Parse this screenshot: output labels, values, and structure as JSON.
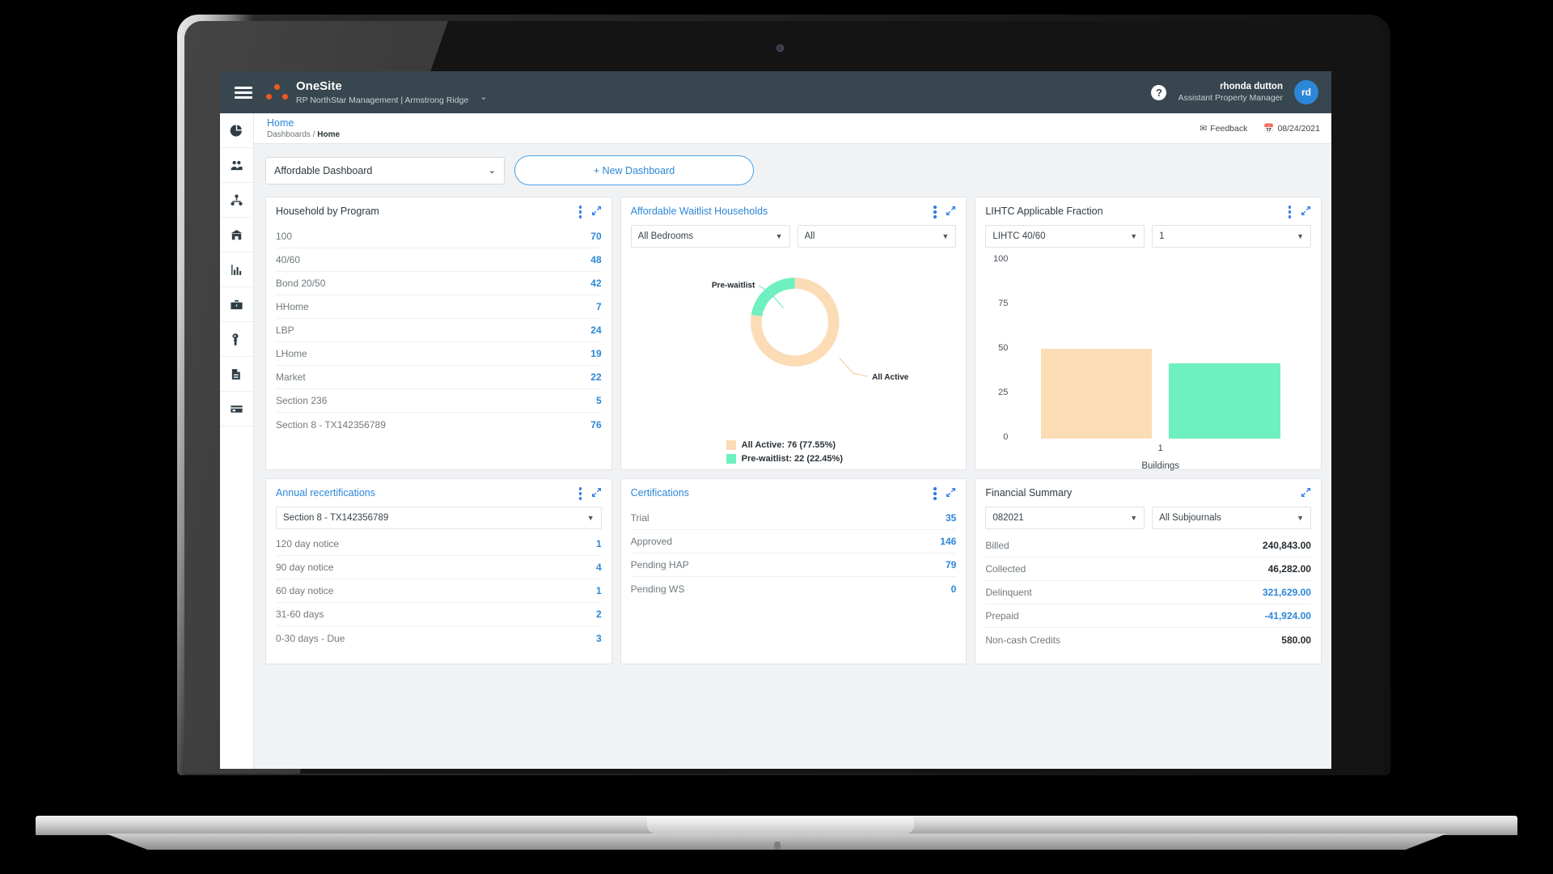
{
  "navbar": {
    "menu_icon": "hamburger-icon",
    "logo_icon": "three-dot-logo",
    "brand_name": "OneSite",
    "brand_sub": "RP NorthStar Management | Armstrong Ridge",
    "brand_caret": "⌄",
    "help_icon": "?",
    "user_name": "rhonda dutton",
    "user_role": "Assistant Property Manager",
    "avatar_initials": "rd",
    "avatar_color": "#2c87d8",
    "bg_color": "#37464f"
  },
  "sidebar": {
    "items": [
      {
        "name": "sidebar-item-dashboards",
        "icon": "pie-chart-icon"
      },
      {
        "name": "sidebar-item-residents",
        "icon": "people-icon"
      },
      {
        "name": "sidebar-item-org",
        "icon": "org-chart-icon"
      },
      {
        "name": "sidebar-item-property",
        "icon": "building-icon"
      },
      {
        "name": "sidebar-item-reports",
        "icon": "bar-chart-icon"
      },
      {
        "name": "sidebar-item-accounting",
        "icon": "briefcase-icon"
      },
      {
        "name": "sidebar-item-maintenance",
        "icon": "wrench-icon"
      },
      {
        "name": "sidebar-item-documents",
        "icon": "documents-icon"
      },
      {
        "name": "sidebar-item-payments",
        "icon": "card-icon"
      }
    ]
  },
  "breadcrumb": {
    "title": "Home",
    "path_prefix": "Dashboards / ",
    "path_current": "Home",
    "feedback_label": "Feedback",
    "feedback_icon": "envelope-icon",
    "date": "08/24/2021",
    "date_icon": "calendar-icon"
  },
  "toolbar": {
    "dashboard_select": "Affordable Dashboard",
    "caret": "⌄",
    "new_dashboard_label": "+ New Dashboard"
  },
  "colors": {
    "accent_blue": "#2c87d8",
    "peach": "#fbdcb5",
    "green": "#6ff0c0",
    "navbar": "#37464f"
  },
  "cards": {
    "household_by_program": {
      "title": "Household by Program",
      "rows": [
        {
          "label": "100",
          "value": "70"
        },
        {
          "label": "40/60",
          "value": "48"
        },
        {
          "label": "Bond 20/50",
          "value": "42"
        },
        {
          "label": "HHome",
          "value": "7"
        },
        {
          "label": "LBP",
          "value": "24"
        },
        {
          "label": "LHome",
          "value": "19"
        },
        {
          "label": "Market",
          "value": "22"
        },
        {
          "label": "Section 236",
          "value": "5"
        },
        {
          "label": "Section 8 - TX142356789",
          "value": "76"
        }
      ]
    },
    "affordable_waitlist": {
      "title": "Affordable Waitlist Households",
      "filter_bedrooms": "All Bedrooms",
      "filter_status": "All",
      "label_pre": "Pre-waitlist",
      "label_active": "All Active",
      "legend": [
        "All Active: 76 (77.55%)",
        "Pre-waitlist: 22 (22.45%)"
      ]
    },
    "lihtc": {
      "title": "LIHTC Applicable Fraction",
      "filter_program": "LIHTC 40/60",
      "filter_building": "1"
    },
    "annual_recerts": {
      "title": "Annual recertifications",
      "filter": "Section 8 - TX142356789",
      "rows": [
        {
          "label": "120 day notice",
          "value": "1"
        },
        {
          "label": "90 day notice",
          "value": "4"
        },
        {
          "label": "60 day notice",
          "value": "1"
        },
        {
          "label": "31-60 days",
          "value": "2"
        },
        {
          "label": "0-30 days - Due",
          "value": "3"
        }
      ]
    },
    "certifications": {
      "title": "Certifications",
      "rows": [
        {
          "label": "Trial",
          "value": "35"
        },
        {
          "label": "Approved",
          "value": "146"
        },
        {
          "label": "Pending HAP",
          "value": "79"
        },
        {
          "label": "Pending WS",
          "value": "0"
        }
      ]
    },
    "financial_summary": {
      "title": "Financial Summary",
      "filter_period": "082021",
      "filter_subjournal": "All Subjournals",
      "rows": [
        {
          "label": "Billed",
          "value": "240,843.00",
          "style": "dark"
        },
        {
          "label": "Collected",
          "value": "46,282.00",
          "style": "dark"
        },
        {
          "label": "Delinquent",
          "value": "321,629.00",
          "style": "blue"
        },
        {
          "label": "Prepaid",
          "value": "-41,924.00",
          "style": "blue"
        },
        {
          "label": "Non-cash Credits",
          "value": "580.00",
          "style": "dark"
        }
      ]
    }
  },
  "chart_data": [
    {
      "type": "pie",
      "title": "Affordable Waitlist Households",
      "labels": [
        "All Active",
        "Pre-waitlist"
      ],
      "values": [
        76,
        22
      ],
      "percentages": [
        77.55,
        22.45
      ],
      "colors": [
        "#fbdcb5",
        "#6ff0c0"
      ],
      "donut": true,
      "legend": "bottom",
      "annotations": [
        "Pre-waitlist",
        "All Active"
      ]
    },
    {
      "type": "bar",
      "title": "LIHTC Applicable Fraction",
      "categories": [
        "1"
      ],
      "series": [
        {
          "name": "series-1",
          "values": [
            50
          ],
          "color": "#fbdcb5"
        },
        {
          "name": "series-2",
          "values": [
            42
          ],
          "color": "#6ff0c0"
        }
      ],
      "xlabel": "Buildings",
      "ylabel": "",
      "ylim": [
        0,
        100
      ],
      "yticks": [
        0,
        25,
        50,
        75,
        100
      ],
      "grid": false
    }
  ]
}
